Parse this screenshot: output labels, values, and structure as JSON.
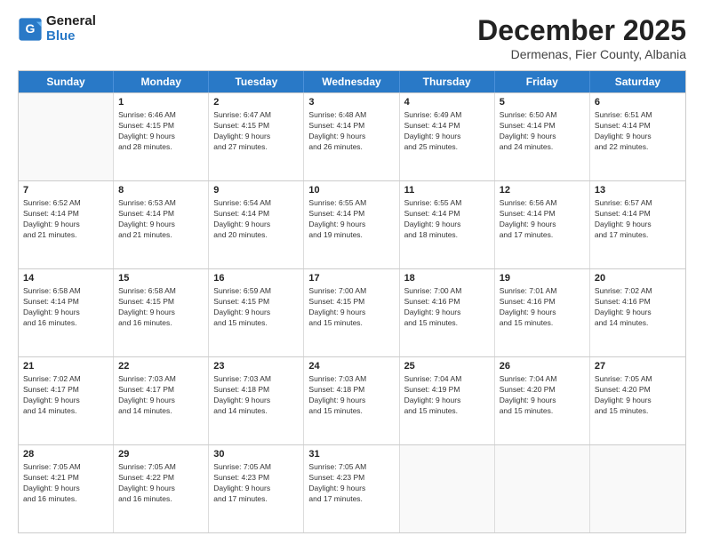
{
  "header": {
    "logo_line1": "General",
    "logo_line2": "Blue",
    "month_title": "December 2025",
    "location": "Dermenas, Fier County, Albania"
  },
  "weekdays": [
    "Sunday",
    "Monday",
    "Tuesday",
    "Wednesday",
    "Thursday",
    "Friday",
    "Saturday"
  ],
  "rows": [
    [
      {
        "day": "",
        "text": ""
      },
      {
        "day": "1",
        "text": "Sunrise: 6:46 AM\nSunset: 4:15 PM\nDaylight: 9 hours\nand 28 minutes."
      },
      {
        "day": "2",
        "text": "Sunrise: 6:47 AM\nSunset: 4:15 PM\nDaylight: 9 hours\nand 27 minutes."
      },
      {
        "day": "3",
        "text": "Sunrise: 6:48 AM\nSunset: 4:14 PM\nDaylight: 9 hours\nand 26 minutes."
      },
      {
        "day": "4",
        "text": "Sunrise: 6:49 AM\nSunset: 4:14 PM\nDaylight: 9 hours\nand 25 minutes."
      },
      {
        "day": "5",
        "text": "Sunrise: 6:50 AM\nSunset: 4:14 PM\nDaylight: 9 hours\nand 24 minutes."
      },
      {
        "day": "6",
        "text": "Sunrise: 6:51 AM\nSunset: 4:14 PM\nDaylight: 9 hours\nand 22 minutes."
      }
    ],
    [
      {
        "day": "7",
        "text": "Sunrise: 6:52 AM\nSunset: 4:14 PM\nDaylight: 9 hours\nand 21 minutes."
      },
      {
        "day": "8",
        "text": "Sunrise: 6:53 AM\nSunset: 4:14 PM\nDaylight: 9 hours\nand 21 minutes."
      },
      {
        "day": "9",
        "text": "Sunrise: 6:54 AM\nSunset: 4:14 PM\nDaylight: 9 hours\nand 20 minutes."
      },
      {
        "day": "10",
        "text": "Sunrise: 6:55 AM\nSunset: 4:14 PM\nDaylight: 9 hours\nand 19 minutes."
      },
      {
        "day": "11",
        "text": "Sunrise: 6:55 AM\nSunset: 4:14 PM\nDaylight: 9 hours\nand 18 minutes."
      },
      {
        "day": "12",
        "text": "Sunrise: 6:56 AM\nSunset: 4:14 PM\nDaylight: 9 hours\nand 17 minutes."
      },
      {
        "day": "13",
        "text": "Sunrise: 6:57 AM\nSunset: 4:14 PM\nDaylight: 9 hours\nand 17 minutes."
      }
    ],
    [
      {
        "day": "14",
        "text": "Sunrise: 6:58 AM\nSunset: 4:14 PM\nDaylight: 9 hours\nand 16 minutes."
      },
      {
        "day": "15",
        "text": "Sunrise: 6:58 AM\nSunset: 4:15 PM\nDaylight: 9 hours\nand 16 minutes."
      },
      {
        "day": "16",
        "text": "Sunrise: 6:59 AM\nSunset: 4:15 PM\nDaylight: 9 hours\nand 15 minutes."
      },
      {
        "day": "17",
        "text": "Sunrise: 7:00 AM\nSunset: 4:15 PM\nDaylight: 9 hours\nand 15 minutes."
      },
      {
        "day": "18",
        "text": "Sunrise: 7:00 AM\nSunset: 4:16 PM\nDaylight: 9 hours\nand 15 minutes."
      },
      {
        "day": "19",
        "text": "Sunrise: 7:01 AM\nSunset: 4:16 PM\nDaylight: 9 hours\nand 15 minutes."
      },
      {
        "day": "20",
        "text": "Sunrise: 7:02 AM\nSunset: 4:16 PM\nDaylight: 9 hours\nand 14 minutes."
      }
    ],
    [
      {
        "day": "21",
        "text": "Sunrise: 7:02 AM\nSunset: 4:17 PM\nDaylight: 9 hours\nand 14 minutes."
      },
      {
        "day": "22",
        "text": "Sunrise: 7:03 AM\nSunset: 4:17 PM\nDaylight: 9 hours\nand 14 minutes."
      },
      {
        "day": "23",
        "text": "Sunrise: 7:03 AM\nSunset: 4:18 PM\nDaylight: 9 hours\nand 14 minutes."
      },
      {
        "day": "24",
        "text": "Sunrise: 7:03 AM\nSunset: 4:18 PM\nDaylight: 9 hours\nand 15 minutes."
      },
      {
        "day": "25",
        "text": "Sunrise: 7:04 AM\nSunset: 4:19 PM\nDaylight: 9 hours\nand 15 minutes."
      },
      {
        "day": "26",
        "text": "Sunrise: 7:04 AM\nSunset: 4:20 PM\nDaylight: 9 hours\nand 15 minutes."
      },
      {
        "day": "27",
        "text": "Sunrise: 7:05 AM\nSunset: 4:20 PM\nDaylight: 9 hours\nand 15 minutes."
      }
    ],
    [
      {
        "day": "28",
        "text": "Sunrise: 7:05 AM\nSunset: 4:21 PM\nDaylight: 9 hours\nand 16 minutes."
      },
      {
        "day": "29",
        "text": "Sunrise: 7:05 AM\nSunset: 4:22 PM\nDaylight: 9 hours\nand 16 minutes."
      },
      {
        "day": "30",
        "text": "Sunrise: 7:05 AM\nSunset: 4:23 PM\nDaylight: 9 hours\nand 17 minutes."
      },
      {
        "day": "31",
        "text": "Sunrise: 7:05 AM\nSunset: 4:23 PM\nDaylight: 9 hours\nand 17 minutes."
      },
      {
        "day": "",
        "text": ""
      },
      {
        "day": "",
        "text": ""
      },
      {
        "day": "",
        "text": ""
      }
    ]
  ]
}
